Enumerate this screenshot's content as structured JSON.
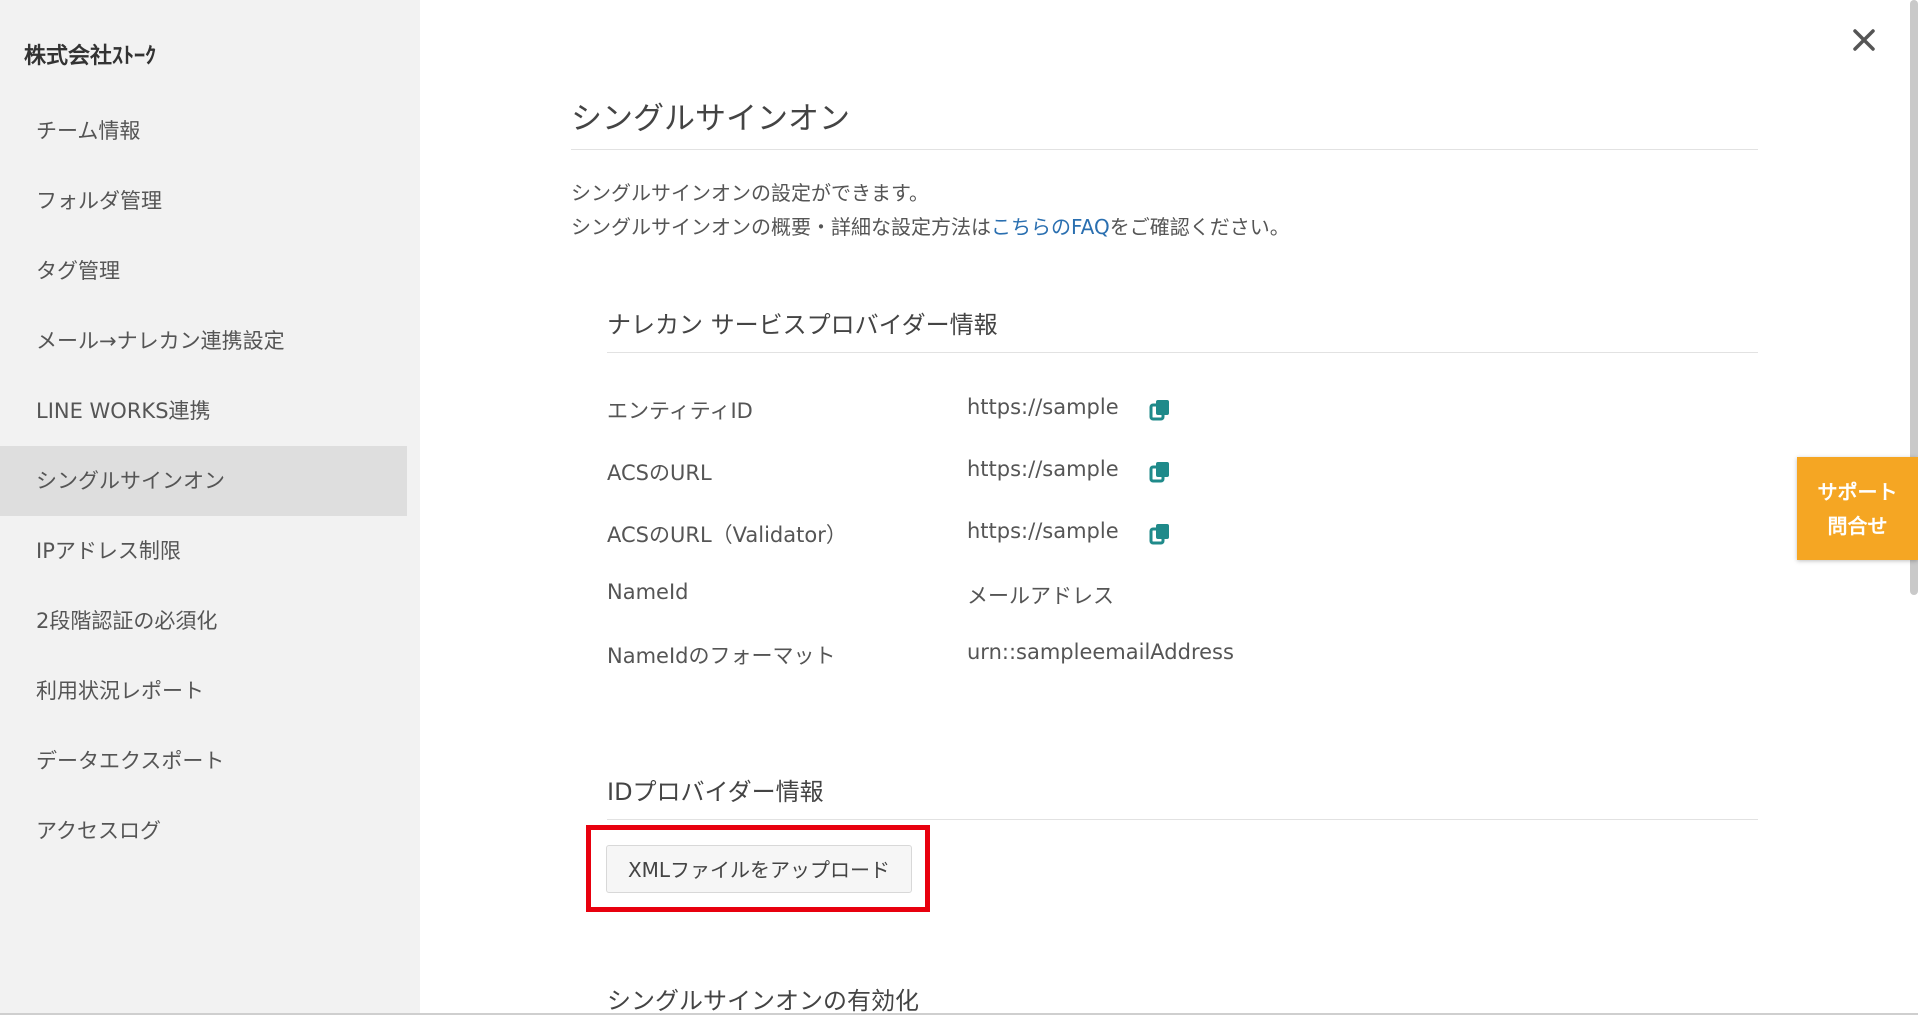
{
  "sidebar": {
    "company": "株式会社ｽﾄｰｸ",
    "items": [
      {
        "label": "チーム情報"
      },
      {
        "label": "フォルダ管理"
      },
      {
        "label": "タグ管理"
      },
      {
        "label": "メール→ナレカン連携設定"
      },
      {
        "label": "LINE WORKS連携"
      },
      {
        "label": "シングルサインオン",
        "active": true
      },
      {
        "label": "IPアドレス制限"
      },
      {
        "label": "2段階認証の必須化"
      },
      {
        "label": "利用状況レポート"
      },
      {
        "label": "データエクスポート"
      },
      {
        "label": "アクセスログ"
      }
    ]
  },
  "main": {
    "title": "シングルサインオン",
    "description_line1": "シングルサインオンの設定ができます。",
    "description_line2_prefix": "シングルサインオンの概要・詳細な設定方法は",
    "description_link": "こちらのFAQ",
    "description_line2_suffix": "をご確認ください。",
    "sp_section": {
      "title": "ナレカン サービスプロバイダー情報",
      "rows": [
        {
          "label": "エンティティID",
          "value": "https://sample"
        },
        {
          "label": "ACSのURL",
          "value": "https://sample"
        },
        {
          "label": "ACSのURL（Validator）",
          "value": "https://sample"
        },
        {
          "label": "NameId",
          "value": "メールアドレス"
        },
        {
          "label": "NameIdのフォーマット",
          "value": "urn::sampleemailAddress"
        }
      ]
    },
    "idp_section": {
      "title": "IDプロバイダー情報",
      "upload_button": "XMLファイルをアップロード"
    },
    "enable_section": {
      "title": "シングルサインオンの有効化"
    }
  },
  "support": {
    "line1": "サポート",
    "line2": "問合せ"
  },
  "colors": {
    "accent_support": "#f5a623",
    "link": "#2a6fb0",
    "copy_icon": "#1f8a8a",
    "highlight_border": "#e8000e"
  },
  "icons": {
    "close": "close-icon",
    "copy": "copy-icon"
  }
}
